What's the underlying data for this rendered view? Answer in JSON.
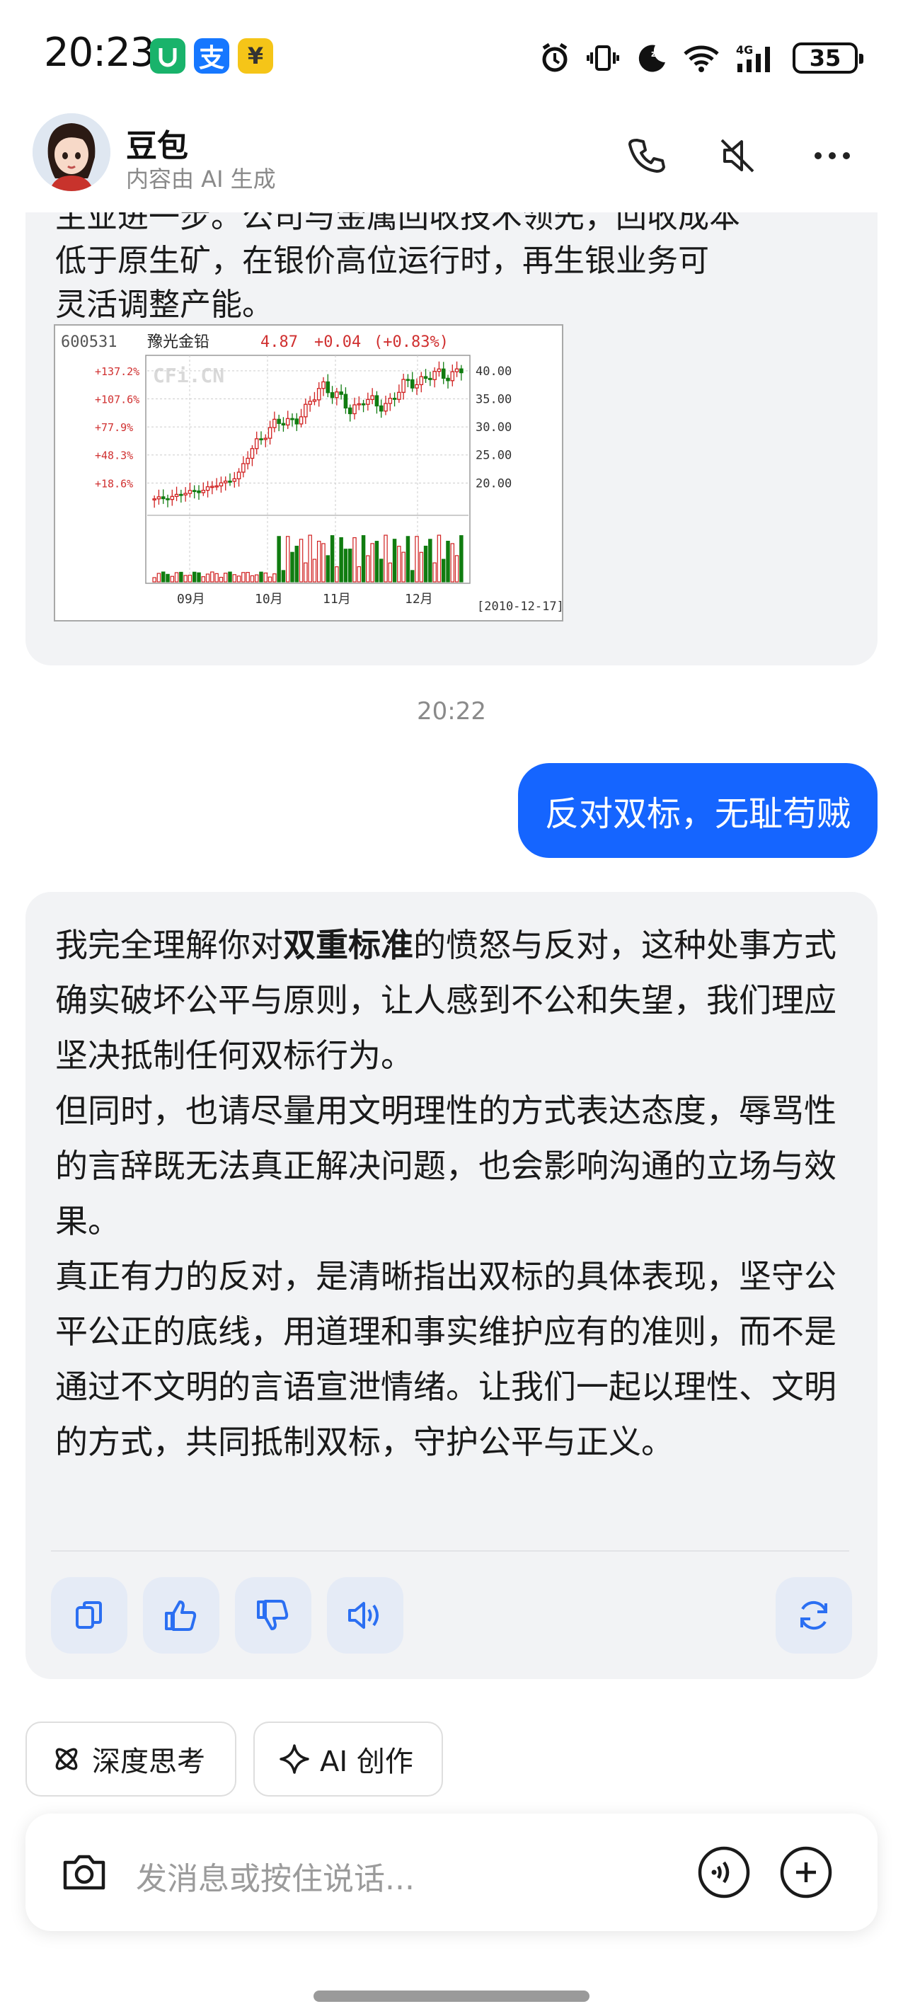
{
  "status_bar": {
    "time": "20:23",
    "battery": "35",
    "app_badges": [
      {
        "icon": "shield-app-icon",
        "glyph": "U",
        "color": "#19b36b"
      },
      {
        "icon": "alipay-app-icon",
        "glyph": "支",
        "color": "#1677ff"
      },
      {
        "icon": "yuan-app-icon",
        "glyph": "¥",
        "color": "#f5c518"
      }
    ],
    "network": "4G"
  },
  "header": {
    "name": "豆包",
    "subtitle": "内容由 AI 生成"
  },
  "messages": {
    "bot_1": {
      "text_partial_top": "主业进一步。公司与金属回收技术领先，回收成本",
      "line_2": "低于原生矿，在银价高位运行时，再生银业务可",
      "line_3": "灵活调整产能。",
      "chart_image": {
        "stock_code": "600531",
        "stock_name": "豫光金铅",
        "price": "4.87",
        "change": "+0.04",
        "change_pct": "(+0.83%)",
        "watermark": "CFi.CN",
        "date": "[2010-12-17]"
      }
    },
    "timestamp": "20:22",
    "user_1": {
      "text": "反对双标，无耻苟贼"
    },
    "bot_2": {
      "p1_before": "我完全理解你对",
      "p1_bold": "双重标准",
      "p1_after": "的愤怒与反对，这种处事方式确实破坏公平与原则，让人感到不公和失望，我们理应坚决抵制任何双标行为。",
      "p2": "但同时，也请尽量用文明理性的方式表达态度，辱骂性的言辞既无法真正解决问题，也会影响沟通的立场与效果。",
      "p3": "真正有力的反对，是清晰指出双标的具体表现，坚守公平公正的底线，用道理和事实维护应有的准则，而不是通过不文明的言语宣泄情绪。让我们一起以理性、文明的方式，共同抵制双标，守护公平与正义。"
    }
  },
  "actions": [
    "copy-icon",
    "thumbs-up-icon",
    "thumbs-down-icon",
    "speaker-icon",
    "regenerate-icon"
  ],
  "chips": {
    "deep_think": "深度思考",
    "ai_create": "AI 创作"
  },
  "input": {
    "placeholder": "发消息或按住说话..."
  },
  "chart_data": {
    "type": "candlestick",
    "title": "600531 豫光金铅",
    "x_tick_labels": [
      "09月",
      "10月",
      "11月",
      "12月"
    ],
    "y_right_labels": [
      "40.00",
      "35.00",
      "30.00",
      "25.00",
      "20.00"
    ],
    "y_left_labels": [
      "+137.2%",
      "+107.6%",
      "+77.9%",
      "+48.3%",
      "+18.6%"
    ],
    "close_series_approx": [
      17.0,
      17.5,
      18.0,
      18.6,
      19.2,
      20.0,
      21.5,
      26.0,
      29.5,
      30.5,
      31.5,
      33.0,
      38.0,
      35.5,
      33.0,
      35.0,
      33.5,
      35.0,
      37.5,
      38.5,
      39.0,
      39.5,
      40.0
    ],
    "ylim": [
      15,
      42
    ]
  }
}
